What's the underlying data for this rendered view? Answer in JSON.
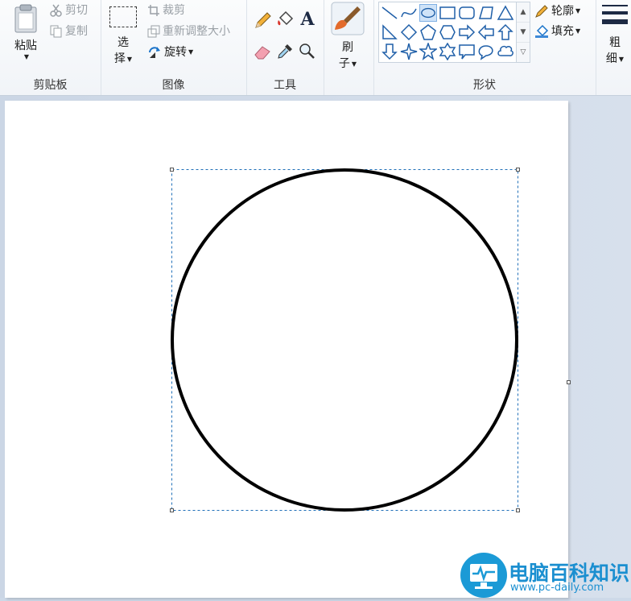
{
  "clipboard": {
    "paste_label": "粘贴",
    "cut_label": "剪切",
    "copy_label": "复制",
    "group_label": "剪贴板"
  },
  "image": {
    "select_top": "选",
    "select_bottom": "择",
    "crop_label": "裁剪",
    "resize_label": "重新调整大小",
    "rotate_label": "旋转",
    "group_label": "图像"
  },
  "tools": {
    "text_tool_glyph": "A",
    "group_label": "工具"
  },
  "brushes": {
    "label_top": "刷",
    "label_bottom": "子"
  },
  "shapes": {
    "outline_label": "轮廓",
    "fill_label": "填充",
    "group_label": "形状",
    "selected_shape": "oval"
  },
  "size": {
    "label_top": "粗",
    "label_bottom": "细"
  },
  "watermark": {
    "title": "电脑百科知识",
    "url": "www.pc-daily.com"
  },
  "colors": {
    "accent": "#1b9ad6",
    "ribbon_bg": "#f5f7fa",
    "workspace_bg": "#cdd9e8",
    "canvas_bg": "#ffffff",
    "stroke": "#000000"
  }
}
